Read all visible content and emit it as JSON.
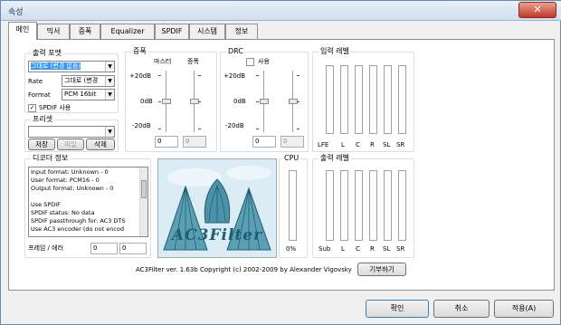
{
  "window": {
    "title": "속성",
    "close_label": "✕"
  },
  "tabs": [
    "메인",
    "믹서",
    "증폭",
    "Equalizer",
    "SPDIF",
    "시스템",
    "정보"
  ],
  "output_format": {
    "title": "출력 포맷",
    "format_select": "그대로 (변경 없음)",
    "rate_label": "Rate",
    "rate_select": "그대로 (변경",
    "format_label": "Format",
    "format2_select": "PCM 16bit",
    "spdif_checkbox": "SPDIF 사용",
    "spdif_checked": true
  },
  "presets": {
    "title": "프리셋",
    "select": "",
    "save": "저장",
    "file": "파일",
    "delete": "삭제"
  },
  "gain": {
    "title": "증폭",
    "master_label": "마스터",
    "gain_label": "증폭",
    "scale": [
      "+20dB",
      "0dB",
      "-20dB"
    ],
    "master_value": "0",
    "gain_value": "0"
  },
  "drc": {
    "title": "DRC",
    "use_label": "사용",
    "use_checked": false,
    "scale": [
      "+20dB",
      "0dB",
      "-20dB"
    ],
    "value1": "0",
    "value2": "0"
  },
  "input_levels": {
    "title": "입력 레벨",
    "channels": [
      "LFE",
      "L",
      "C",
      "R",
      "SL",
      "SR"
    ]
  },
  "decoder_info": {
    "title": "디코더 정보",
    "lines": [
      "Input format: Unknown - 0",
      "User format: PCM16 - 0",
      "Output format: Unknown - 0",
      "",
      "Use SPDIF",
      "   SPDIF status: No data",
      "   SPDIF passthrough for: AC3 DTS",
      "   Use AC3 encoder (do not encod"
    ],
    "frames_label": "프레임 / 에러",
    "frames_value": "0",
    "errors_value": "0"
  },
  "cpu": {
    "title": "CPU",
    "value": "0%"
  },
  "output_levels": {
    "title": "출력 레벨",
    "channels": [
      "Sub",
      "L",
      "C",
      "R",
      "SL",
      "SR"
    ]
  },
  "logo": {
    "text": "AC3Filter"
  },
  "footer": {
    "copyright": "AC3Filter ver. 1.63b Copyright (c) 2002-2009 by Alexander Vigovsky",
    "donate": "기부하기"
  },
  "buttons": {
    "ok": "확인",
    "cancel": "취소",
    "apply": "적용(A)"
  },
  "colors": {
    "tab_border": "#8e8f8f",
    "logo_bg": "#cfe6f2",
    "logo_teal": "#2e7f99",
    "highlight": "#3399ff"
  }
}
